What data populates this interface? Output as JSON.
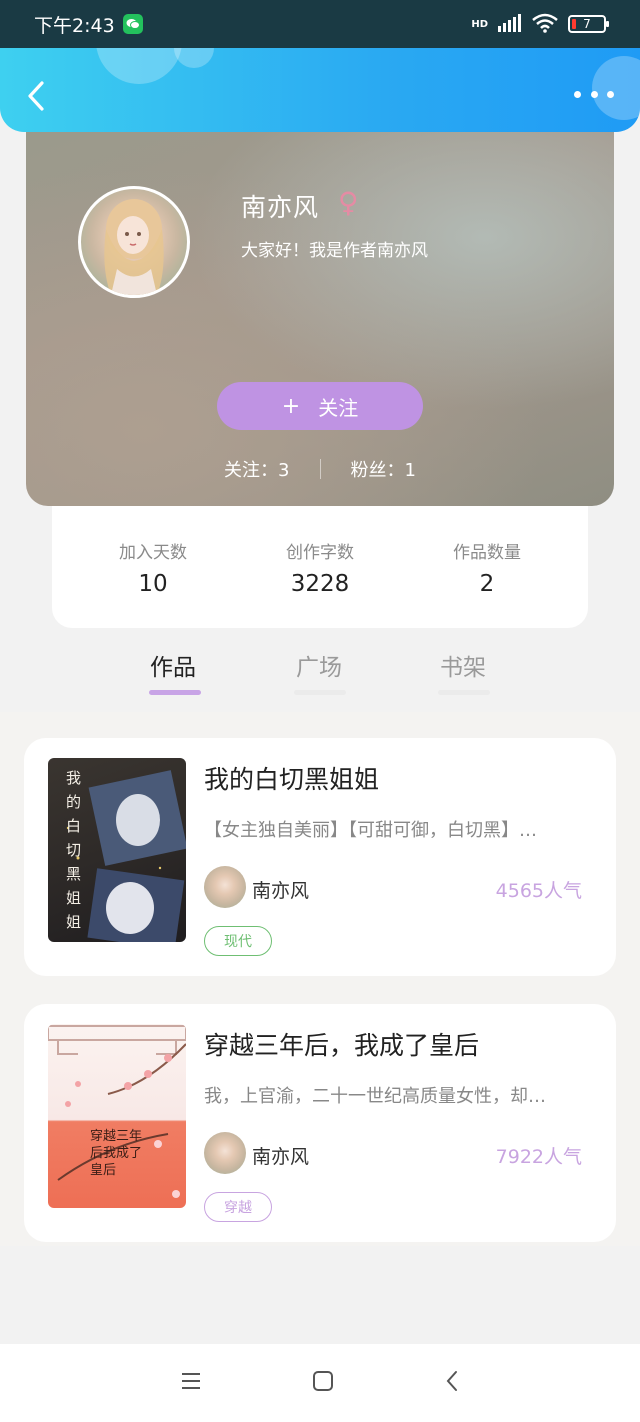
{
  "status_bar": {
    "time": "下午2:43",
    "network": "HD",
    "battery": "7"
  },
  "profile": {
    "name": "南亦风",
    "gender_symbol": "♀",
    "bio": "大家好！我是作者南亦风",
    "follow_plus": "+",
    "follow_label": "关注",
    "following": "关注：3",
    "fans": "粉丝：1"
  },
  "stats": [
    {
      "label": "加入天数",
      "value": "10"
    },
    {
      "label": "创作字数",
      "value": "3228"
    },
    {
      "label": "作品数量",
      "value": "2"
    }
  ],
  "tabs": [
    {
      "label": "作品",
      "active": true
    },
    {
      "label": "广场",
      "active": false
    },
    {
      "label": "书架",
      "active": false
    }
  ],
  "books": [
    {
      "title": "我的白切黑姐姐",
      "desc": "【女主独自美丽】【可甜可御，白切黑】…",
      "author": "南亦风",
      "popularity": "4565人气",
      "tag": "现代",
      "tag_color": "#6fbf73",
      "cover_text": "我的白切黑姐姐"
    },
    {
      "title": "穿越三年后，我成了皇后",
      "desc": "我，上官渝，二十一世纪高质量女性，却…",
      "author": "南亦风",
      "popularity": "7922人气",
      "tag": "穿越",
      "tag_color": "#c8a4e0",
      "cover_text": "穿越三年后我成了皇后"
    }
  ],
  "colors": {
    "header_gradient_start": "#3ed0f0",
    "header_gradient_end": "#1f9bf5",
    "accent_purple": "#bf93e3",
    "popularity_color": "#c8a4e0"
  }
}
